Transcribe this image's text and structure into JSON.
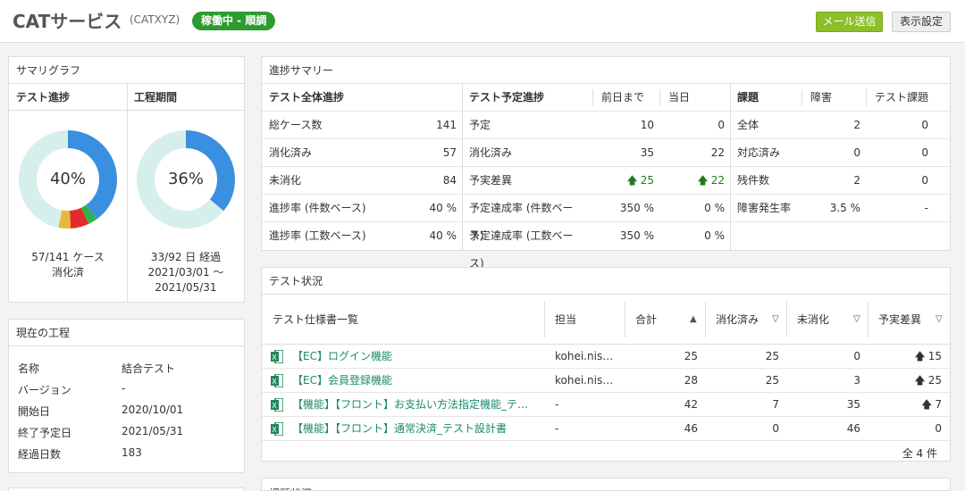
{
  "header": {
    "title": "CATサービス",
    "code": "(CATXYZ)",
    "status": "稼働中 - 順調",
    "mail_button": "メール送信",
    "display_button": "表示設定",
    "colors": {
      "status": "#2e9b2e",
      "mail": "#8cbf2a"
    }
  },
  "summary_graph": {
    "title": "サマリグラフ",
    "test_progress": {
      "heading": "テスト進捗",
      "percent_label": "40%",
      "caption_line1": "57/141 ケース",
      "caption_line2": "消化済",
      "segments": [
        {
          "name": "done",
          "value": 40,
          "color": "#3a8fe0"
        },
        {
          "name": "green",
          "value": 3,
          "color": "#2db34a"
        },
        {
          "name": "red",
          "value": 6,
          "color": "#e22b2b"
        },
        {
          "name": "yellow",
          "value": 4,
          "color": "#e8b83a"
        },
        {
          "name": "rest",
          "value": 47,
          "color": "#d6eeec"
        }
      ]
    },
    "period": {
      "heading": "工程期間",
      "percent_label": "36%",
      "caption_line1": "33/92 日 経過",
      "caption_line2": "2021/03/01 ～",
      "caption_line3": "2021/05/31",
      "segments": [
        {
          "name": "elapsed",
          "value": 36,
          "color": "#3a8fe0"
        },
        {
          "name": "rest",
          "value": 64,
          "color": "#d6eeec"
        }
      ]
    }
  },
  "current_process": {
    "title": "現在の工程",
    "items": [
      {
        "label": "名称",
        "value": "結合テスト"
      },
      {
        "label": "バージョン",
        "value": "-"
      },
      {
        "label": "開始日",
        "value": "2020/10/01"
      },
      {
        "label": "終了予定日",
        "value": "2021/05/31"
      },
      {
        "label": "経過日数",
        "value": "183"
      }
    ]
  },
  "progress_summary": {
    "title": "進捗サマリー",
    "overall": {
      "heading": "テスト全体進捗",
      "rows": [
        {
          "label": "総ケース数",
          "value": "141"
        },
        {
          "label": "消化済み",
          "value": "57"
        },
        {
          "label": "未消化",
          "value": "84"
        },
        {
          "label": "進捗率 (件数ベース)",
          "value": "40 %"
        },
        {
          "label": "進捗率 (工数ベース)",
          "value": "40 %"
        }
      ]
    },
    "plan": {
      "heading": "テスト予定進捗",
      "col_prev": "前日まで",
      "col_today": "当日",
      "rows": [
        {
          "label": "予定",
          "prev": "10",
          "today": "0"
        },
        {
          "label": "消化済み",
          "prev": "35",
          "today": "22"
        },
        {
          "label": "予実差異",
          "prev": "25",
          "today": "22"
        },
        {
          "label": "予定達成率 (件数ベース)",
          "prev": "350 %",
          "today": "0 %"
        },
        {
          "label": "予定達成率 (工数ベース)",
          "prev": "350 %",
          "today": "0 %"
        }
      ]
    },
    "issues": {
      "heading": "課題",
      "col_fault": "障害",
      "col_test": "テスト課題",
      "rows": [
        {
          "label": "全体",
          "fault": "2",
          "test": "0"
        },
        {
          "label": "対応済み",
          "fault": "0",
          "test": "0"
        },
        {
          "label": "残件数",
          "fault": "2",
          "test": "0"
        },
        {
          "label": "障害発生率",
          "fault": "3.5 %",
          "test": "-"
        }
      ]
    }
  },
  "test_status": {
    "title": "テスト状況",
    "columns": {
      "spec": "テスト仕様書一覧",
      "owner": "担当",
      "total": "合計",
      "done": "消化済み",
      "undone": "未消化",
      "diff": "予実差異"
    },
    "rows": [
      {
        "name": "【EC】ログイン機能",
        "owner": "kohei.nis…",
        "total": "25",
        "done": "25",
        "undone": "0",
        "diff": "15",
        "diff_up": true
      },
      {
        "name": "【EC】会員登録機能",
        "owner": "kohei.nis…",
        "total": "28",
        "done": "25",
        "undone": "3",
        "diff": "25",
        "diff_up": true
      },
      {
        "name": "【機能】【フロント】お支払い方法指定機能_テ…",
        "owner": "-",
        "total": "42",
        "done": "7",
        "undone": "35",
        "diff": "7",
        "diff_up": true
      },
      {
        "name": "【機能】【フロント】通常決済_テスト設計書",
        "owner": "-",
        "total": "46",
        "done": "0",
        "undone": "46",
        "diff": "0",
        "diff_up": false
      }
    ],
    "footer": "全 4 件"
  },
  "issue_status": {
    "title": "課題状況"
  }
}
